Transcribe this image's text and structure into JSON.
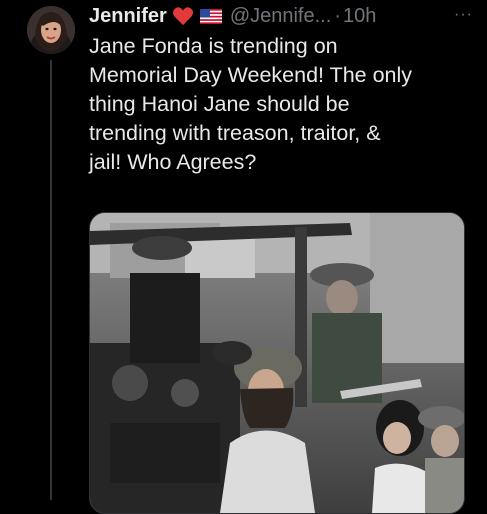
{
  "tweet": {
    "author_name": "Jennifer",
    "handle": "@Jennife...",
    "separator": "·",
    "time": "10h",
    "more_label": "···",
    "text_lines": [
      "Jane Fonda is trending on",
      "Memorial Day Weekend! The only",
      "thing Hanoi Jane should be",
      "trending with treason, traitor, &",
      "jail! Who Agrees?"
    ],
    "badges": [
      "heart-icon",
      "us-flag-icon"
    ],
    "media_type": "photo",
    "colors": {
      "background": "#000000",
      "text": "#e7e9ea",
      "secondary": "#71767b",
      "heart": "#f91880"
    }
  }
}
